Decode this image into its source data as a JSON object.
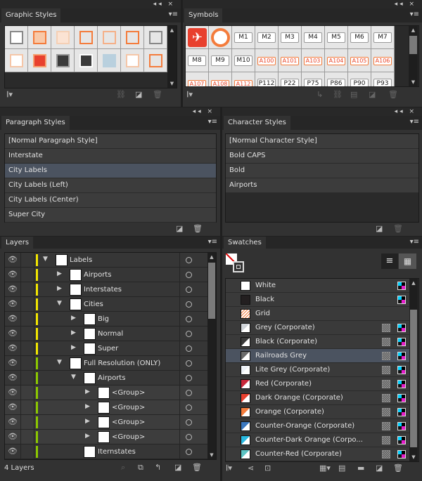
{
  "header_controls": "◂◂ ×",
  "graphic_styles": {
    "title": "Graphic Styles",
    "cells": [
      {
        "fill": "#ffffff",
        "border": "#888888"
      },
      {
        "fill": "#f9c9a8",
        "border": "#f47c3c"
      },
      {
        "fill": "#fbe3d3",
        "border": "#f5d0b5"
      },
      {
        "fill": "#e6e6e6",
        "border": "#f47c3c"
      },
      {
        "fill": "#e6e6e6",
        "border": "#f5b088"
      },
      {
        "fill": "#e6e6e6",
        "border": "#f47c3c"
      },
      {
        "fill": "#e6e6e6",
        "border": "#888888"
      },
      {
        "fill": "#ffffff",
        "border": "#f5c6a8"
      },
      {
        "fill": "#e8402e",
        "border": "#f5a070"
      },
      {
        "fill": "#3a3a3a",
        "border": "#999999"
      },
      {
        "fill": "#3a3a3a",
        "border": "#ffffff"
      },
      {
        "fill": "#b9d0de",
        "border": "#b9d0de"
      },
      {
        "fill": "#ffffff",
        "border": "#f5c6a8"
      },
      {
        "fill": "#e6e6e6",
        "border": "#f47c3c"
      }
    ]
  },
  "symbols": {
    "title": "Symbols",
    "items": [
      {
        "icon": "airplane-icon"
      },
      {
        "icon": "ring-icon"
      },
      {
        "label": "M1"
      },
      {
        "label": "M2"
      },
      {
        "label": "M3"
      },
      {
        "label": "M4"
      },
      {
        "label": "M5"
      },
      {
        "label": "M6"
      },
      {
        "label": "M7"
      },
      {
        "label": "M8"
      },
      {
        "label": "M9"
      },
      {
        "label": "M10"
      },
      {
        "label": "A100",
        "orange": true
      },
      {
        "label": "A101",
        "orange": true
      },
      {
        "label": "A103",
        "orange": true
      },
      {
        "label": "A104",
        "orange": true
      },
      {
        "label": "A105",
        "orange": true
      },
      {
        "label": "A106",
        "orange": true
      },
      {
        "label": "A107",
        "orange": true
      },
      {
        "label": "A108",
        "orange": true
      },
      {
        "label": "A112",
        "orange": true
      },
      {
        "label": "P112"
      },
      {
        "label": "P22"
      },
      {
        "label": "P75"
      },
      {
        "label": "P86"
      },
      {
        "label": "P90"
      },
      {
        "label": "P93"
      }
    ]
  },
  "paragraph_styles": {
    "title": "Paragraph Styles",
    "items": [
      "[Normal Paragraph Style]",
      "Interstate",
      "City Labels",
      "City Labels (Left)",
      "City Labels (Center)",
      "Super City"
    ],
    "selected": 2
  },
  "character_styles": {
    "title": "Character Styles",
    "items": [
      "[Normal Character Style]",
      "Bold CAPS",
      "Bold",
      "Airports"
    ]
  },
  "layers": {
    "title": "Layers",
    "count": "4 Layers",
    "rows": [
      {
        "name": "Labels",
        "depth": 0,
        "exp": "open",
        "color": "#f2e600"
      },
      {
        "name": "Airports",
        "depth": 1,
        "exp": "closed",
        "color": "#f2e600"
      },
      {
        "name": "Interstates",
        "depth": 1,
        "exp": "closed",
        "color": "#f2e600"
      },
      {
        "name": "Cities",
        "depth": 1,
        "exp": "open",
        "color": "#f2e600"
      },
      {
        "name": "Big",
        "depth": 2,
        "exp": "closed",
        "color": "#f2e600"
      },
      {
        "name": "Normal",
        "depth": 2,
        "exp": "closed",
        "color": "#f2e600"
      },
      {
        "name": "Super",
        "depth": 2,
        "exp": "closed",
        "color": "#f2e600"
      },
      {
        "name": "Full Resolution (ONLY)",
        "depth": 1,
        "exp": "open",
        "color": "#8cc800"
      },
      {
        "name": "Airports",
        "depth": 2,
        "exp": "open",
        "color": "#8cc800"
      },
      {
        "name": "<Group>",
        "depth": 3,
        "exp": "closed",
        "color": "#8cc800",
        "group": true
      },
      {
        "name": "<Group>",
        "depth": 3,
        "exp": "closed",
        "color": "#8cc800",
        "group": true
      },
      {
        "name": "<Group>",
        "depth": 3,
        "exp": "closed",
        "color": "#8cc800",
        "group": true
      },
      {
        "name": "<Group>",
        "depth": 3,
        "exp": "closed",
        "color": "#8cc800",
        "group": true
      },
      {
        "name": "Iternstates",
        "depth": 2,
        "exp": "none",
        "color": "#8cc800"
      }
    ]
  },
  "swatches": {
    "title": "Swatches",
    "selected": 5,
    "items": [
      {
        "name": "White",
        "color": "#ffffff",
        "cmyk": true
      },
      {
        "name": "Black",
        "color": "#231f20",
        "cmyk": true
      },
      {
        "name": "Grid",
        "color": "pattern"
      },
      {
        "name": "Grey (Corporate)",
        "color": "#d1d5da",
        "spot": true,
        "cmyk": true
      },
      {
        "name": "Black (Corporate)",
        "color": "#3a3a3a",
        "spot": true,
        "cmyk": true
      },
      {
        "name": "Railroads Grey",
        "color": "#6b6b6b",
        "spot": true,
        "cmyk": true
      },
      {
        "name": "Lite Grey (Corporate)",
        "color": "#eef2f8",
        "spot": true,
        "cmyk": true
      },
      {
        "name": "Red (Corporate)",
        "color": "#c9283a",
        "spot": true,
        "cmyk": true
      },
      {
        "name": "Dark Orange (Corporate)",
        "color": "#e8402e",
        "spot": true,
        "cmyk": true
      },
      {
        "name": "Orange (Corporate)",
        "color": "#f47c3c",
        "spot": true,
        "cmyk": true
      },
      {
        "name": "Counter-Orange (Corporate)",
        "color": "#3a78c0",
        "spot": true,
        "cmyk": true
      },
      {
        "name": "Counter-Dark Orange (Corpo...",
        "color": "#28b8e0",
        "spot": true,
        "cmyk": true
      },
      {
        "name": "Counter-Red (Corporate)",
        "color": "#5cc4c4",
        "spot": true,
        "cmyk": true
      }
    ]
  }
}
